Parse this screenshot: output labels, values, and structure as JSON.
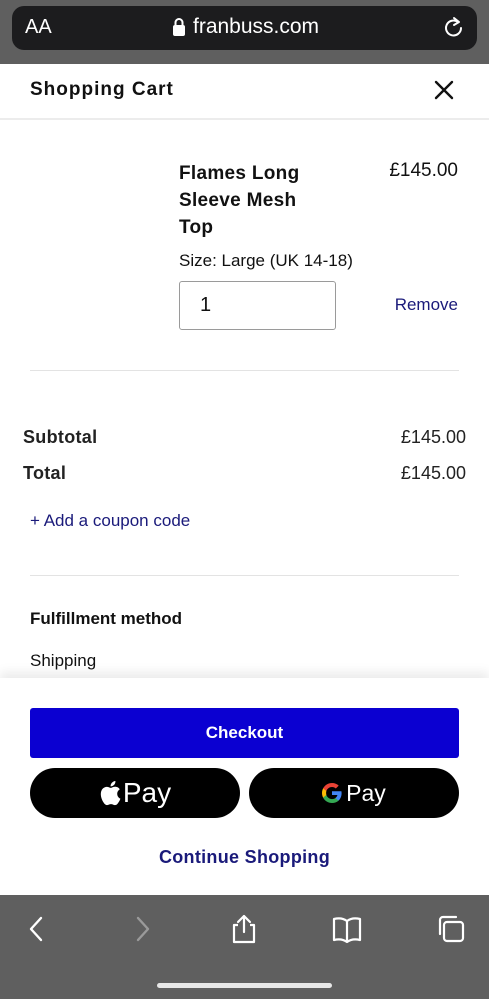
{
  "browser": {
    "aa_label": "AA",
    "domain": "franbuss.com",
    "icons": {
      "lock": "lock-icon",
      "reload": "reload-icon"
    }
  },
  "cart": {
    "title": "Shopping Cart",
    "close_icon": "close-icon"
  },
  "item": {
    "name": "Flames Long Sleeve Mesh Top",
    "price": "£145.00",
    "size": "Size: Large (UK 14-18)",
    "quantity": "1",
    "remove_label": "Remove"
  },
  "summary": {
    "subtotal_label": "Subtotal",
    "subtotal_value": "£145.00",
    "total_label": "Total",
    "total_value": "£145.00",
    "coupon_label": "+ Add a coupon code"
  },
  "fulfillment": {
    "heading": "Fulfillment method",
    "value": "Shipping"
  },
  "actions": {
    "checkout_label": "Checkout",
    "apple_pay_label": "Pay",
    "google_pay_label": "Pay",
    "continue_label": "Continue Shopping"
  },
  "toolbar": {
    "icons": [
      "back-icon",
      "forward-icon",
      "share-icon",
      "bookmarks-icon",
      "tabs-icon"
    ]
  },
  "colors": {
    "accent": "#0b00d1",
    "link": "#1a1a7a",
    "browser_chrome": "#5f5f5f"
  }
}
